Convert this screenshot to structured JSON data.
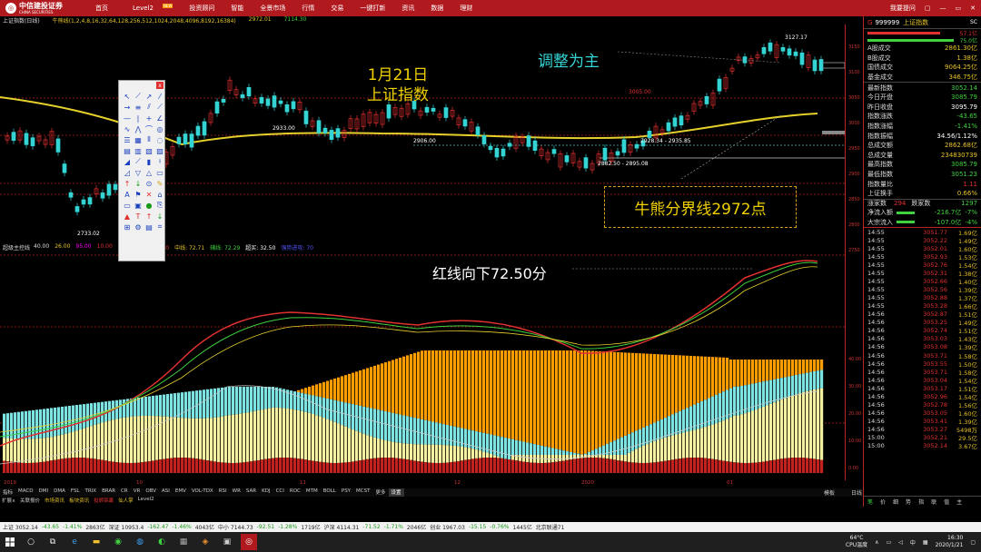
{
  "topbar": {
    "brand_name": "中信建投证券",
    "brand_sub": "CHINA SECURITIES",
    "menu": [
      "首页",
      "Level2",
      "投资顾问",
      "智能",
      "全景市场",
      "行情",
      "交易",
      "一键打新",
      "资讯",
      "数据",
      "理财"
    ],
    "level2_badge": "NEW",
    "help": "我要提问",
    "window_controls": [
      "▢",
      "—",
      "▭",
      "✕"
    ]
  },
  "chart_header": {
    "name": "上证指数(日线)",
    "ma_label": "牛熊线(1,2,4,8,16,32,64,128,256,512,1024,2048,4096,8192,16384)",
    "value1": "2972.01",
    "value2": "7114.30"
  },
  "main_chart": {
    "labels": {
      "high": "3127.17",
      "level1": "3005.00",
      "level2": "2933.00",
      "level3": "2906.00",
      "range1": "2928.34 - 2935.85",
      "range2": "2882.50 - 2895.08",
      "low": "2733.02"
    }
  },
  "price_axis": [
    "3150",
    "3100",
    "3050",
    "3000",
    "2950",
    "2900",
    "2850",
    "2800",
    "2750",
    "40.00",
    "30.00",
    "20.00",
    "10.00",
    "0.00"
  ],
  "annotations": {
    "date_line1": "1月21日",
    "date_line2": "上证指数",
    "adjust": "调整为主",
    "bull_bear": "牛熊分界线2972点",
    "red_line": "红线向下72.50分"
  },
  "indicator_header": {
    "name": "超级主控线",
    "items": [
      {
        "label": "40.00",
        "color": "#ddd"
      },
      {
        "label": "26.00",
        "color": "#e6c229"
      },
      {
        "label": "95.00",
        "color": "#ff00ff"
      },
      {
        "label": "10.00",
        "color": "#e03030"
      },
      {
        "label": "25.00",
        "color": "#ff00ff"
      },
      {
        "label": "主线: 72.50",
        "color": "#e03030"
      },
      {
        "label": "中线: 72.71",
        "color": "#e6c229"
      },
      {
        "label": "辅线: 72.29",
        "color": "#3fd13f"
      },
      {
        "label": "超买: 32.50",
        "color": "#fff"
      },
      {
        "label": "强势进攻: 70",
        "color": "#5555ff"
      }
    ]
  },
  "date_axis": [
    "2019",
    "10",
    "11",
    "12",
    "2020",
    "01"
  ],
  "indicator_tabs": [
    "指标",
    "MACD",
    "DMI",
    "DMA",
    "FSL",
    "TRIX",
    "BRAR",
    "CR",
    "VR",
    "OBV",
    "ASI",
    "EMV",
    "VOL-TDX",
    "RSI",
    "WR",
    "SAR",
    "KDJ",
    "CCI",
    "ROC",
    "MTM",
    "BOLL",
    "PSY",
    "MCST",
    "更多",
    "设置"
  ],
  "sub_tabs": [
    "扩展∧",
    "关联报价",
    "市场资讯",
    "板块资讯",
    "投顾锦囊",
    "仙人掌",
    "Level2"
  ],
  "right_tools": [
    "模板",
    "日线"
  ],
  "quote_panel": {
    "code": "999999",
    "name": "上证指数",
    "tag": "SC",
    "bars": [
      {
        "value": "57.1亿"
      },
      {
        "value": "75.0亿"
      }
    ],
    "rows1": [
      {
        "label": "A股成交",
        "value": "2861.30亿",
        "cls": "y"
      },
      {
        "label": "B股成交",
        "value": "1.38亿",
        "cls": "y"
      },
      {
        "label": "国债成交",
        "value": "9064.25亿",
        "cls": "y"
      },
      {
        "label": "基金成交",
        "value": "346.75亿",
        "cls": "y"
      }
    ],
    "rows2": [
      {
        "label": "最新指数",
        "value": "3052.14",
        "cls": "g"
      },
      {
        "label": "今日开盘",
        "value": "3085.79",
        "cls": "g"
      },
      {
        "label": "昨日收盘",
        "value": "3095.79",
        "cls": "w"
      },
      {
        "label": "指数涨跌",
        "value": "-43.65",
        "cls": "g"
      },
      {
        "label": "指数涨幅",
        "value": "-1.41%",
        "cls": "g"
      },
      {
        "label": "指数振幅",
        "value": "34.56/1.12%",
        "cls": "w"
      },
      {
        "label": "总成交额",
        "value": "2862.68亿",
        "cls": "y"
      },
      {
        "label": "总成交量",
        "value": "234830739",
        "cls": "y"
      },
      {
        "label": "最高指数",
        "value": "3085.79",
        "cls": "g"
      },
      {
        "label": "最低指数",
        "value": "3051.23",
        "cls": "g"
      },
      {
        "label": "指数量比",
        "value": "1.11",
        "cls": ""
      },
      {
        "label": "上证换手",
        "value": "0.66%",
        "cls": "y"
      }
    ],
    "updown": {
      "up_label": "涨家数",
      "up": "294",
      "down_label": "跌家数",
      "down": "1297"
    },
    "flow": [
      {
        "label": "净流入额",
        "value": "-216.7亿",
        "pct": "-7%"
      },
      {
        "label": "大宗流入",
        "value": "-107.0亿",
        "pct": "-4%"
      }
    ],
    "ticks": [
      {
        "t": "14:55",
        "p": "3051.77",
        "v": "1.69亿"
      },
      {
        "t": "14:55",
        "p": "3052.22",
        "v": "1.49亿"
      },
      {
        "t": "14:55",
        "p": "3052.01",
        "v": "1.60亿"
      },
      {
        "t": "14:55",
        "p": "3052.93",
        "v": "1.53亿"
      },
      {
        "t": "14:55",
        "p": "3052.76",
        "v": "1.54亿"
      },
      {
        "t": "14:55",
        "p": "3052.31",
        "v": "1.38亿"
      },
      {
        "t": "14:55",
        "p": "3052.66",
        "v": "1.40亿"
      },
      {
        "t": "14:55",
        "p": "3052.56",
        "v": "1.39亿"
      },
      {
        "t": "14:55",
        "p": "3052.88",
        "v": "1.37亿"
      },
      {
        "t": "14:55",
        "p": "3053.28",
        "v": "1.66亿"
      },
      {
        "t": "14:56",
        "p": "3052.87",
        "v": "1.51亿"
      },
      {
        "t": "14:56",
        "p": "3053.25",
        "v": "1.49亿"
      },
      {
        "t": "14:56",
        "p": "3052.74",
        "v": "1.51亿"
      },
      {
        "t": "14:56",
        "p": "3053.03",
        "v": "1.43亿"
      },
      {
        "t": "14:56",
        "p": "3053.08",
        "v": "1.39亿"
      },
      {
        "t": "14:56",
        "p": "3053.71",
        "v": "1.58亿"
      },
      {
        "t": "14:56",
        "p": "3053.55",
        "v": "1.50亿"
      },
      {
        "t": "14:56",
        "p": "3053.71",
        "v": "1.58亿"
      },
      {
        "t": "14:56",
        "p": "3053.04",
        "v": "1.54亿"
      },
      {
        "t": "14:56",
        "p": "3053.17",
        "v": "1.51亿"
      },
      {
        "t": "14:56",
        "p": "3052.96",
        "v": "1.54亿"
      },
      {
        "t": "14:56",
        "p": "3052.78",
        "v": "1.56亿"
      },
      {
        "t": "14:56",
        "p": "3053.05",
        "v": "1.60亿"
      },
      {
        "t": "14:56",
        "p": "3053.41",
        "v": "1.39亿"
      },
      {
        "t": "14:56",
        "p": "3053.27",
        "v": "5498万"
      },
      {
        "t": "15:00",
        "p": "3052.21",
        "v": "29.5亿"
      },
      {
        "t": "15:00",
        "p": "3052.14",
        "v": "3.67亿"
      }
    ],
    "tabs": [
      "笔",
      "价",
      "细",
      "势",
      "指",
      "联",
      "值",
      "主"
    ]
  },
  "statusbar": {
    "items": [
      {
        "text": "上证 3052.14",
        "cls": ""
      },
      {
        "text": "-43.65",
        "cls": "g"
      },
      {
        "text": "-1.41%",
        "cls": "g"
      },
      {
        "text": "2863亿",
        "cls": ""
      },
      {
        "text": "深证 10953.4",
        "cls": ""
      },
      {
        "text": "-162.47",
        "cls": "g"
      },
      {
        "text": "-1.46%",
        "cls": "g"
      },
      {
        "text": "4043亿",
        "cls": ""
      },
      {
        "text": "中小 7144.73",
        "cls": ""
      },
      {
        "text": "-92.51",
        "cls": "g"
      },
      {
        "text": "-1.28%",
        "cls": "g"
      },
      {
        "text": "1719亿",
        "cls": ""
      },
      {
        "text": "沪深 4114.31",
        "cls": ""
      },
      {
        "text": "-71.52",
        "cls": "g"
      },
      {
        "text": "-1.71%",
        "cls": "g"
      },
      {
        "text": "2046亿",
        "cls": ""
      },
      {
        "text": "创业 1967.03",
        "cls": ""
      },
      {
        "text": "-15.15",
        "cls": "g"
      },
      {
        "text": "-0.76%",
        "cls": "g"
      },
      {
        "text": "1445亿",
        "cls": ""
      },
      {
        "text": "北京联通71",
        "cls": ""
      }
    ]
  },
  "taskbar": {
    "weather_temp": "64°C",
    "weather_label": "CPU温度",
    "ime": "中",
    "time": "16:30",
    "date": "2020/1/21"
  },
  "colors": {
    "up": "#e03030",
    "down": "#3fd13f",
    "ma_yellow": "#e6d12c",
    "orange": "#ff9d00",
    "cyan": "#7de3e3",
    "light_yellow": "#f5f0a0"
  }
}
